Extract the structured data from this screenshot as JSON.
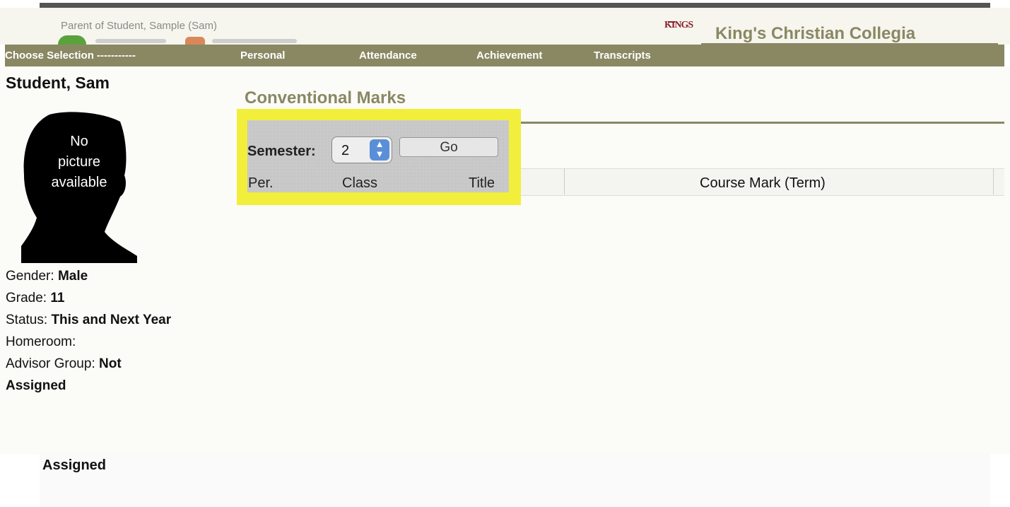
{
  "header": {
    "parent_label": "Parent of Student, Sample (Sam)",
    "logo_text": "KINGS",
    "school_name": "King's Christian Collegia"
  },
  "nav": {
    "choose": "Choose Selection -----------",
    "items": [
      "Personal",
      "Attendance",
      "Achievement",
      "Transcripts"
    ]
  },
  "student": {
    "name": "Student, Sam",
    "photo_text_1": "No",
    "photo_text_2": "picture",
    "photo_text_3": "available",
    "gender_label": "Gender:",
    "gender": "Male",
    "grade_label": "Grade:",
    "grade": "11",
    "status_label": "Status:",
    "status": "This and Next Year",
    "homeroom_label": "Homeroom:",
    "advisor_label": "Advisor Group:",
    "advisor_value_1": "Not",
    "advisor_value_2": "Assigned"
  },
  "marks": {
    "title": "Conventional Marks",
    "semester_label": "Semester:",
    "semester_value": "2",
    "go_label": "Go",
    "columns": [
      "Per.",
      "Class",
      "Title",
      "Course Mark (Term)"
    ]
  },
  "bottom": {
    "assigned": "Assigned"
  },
  "colors": {
    "accent": "#8a8863",
    "highlight": "#f1ef3b",
    "brand": "#8a1f2e"
  }
}
